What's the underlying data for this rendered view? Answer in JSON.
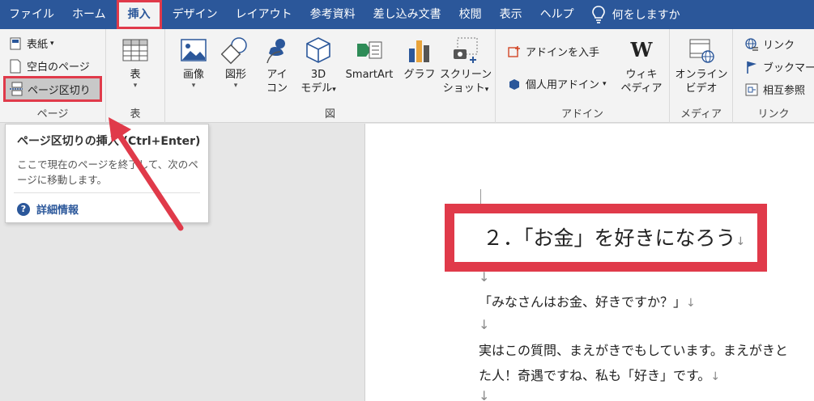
{
  "tabs": [
    {
      "label": "ファイル"
    },
    {
      "label": "ホーム"
    },
    {
      "label": "挿入"
    },
    {
      "label": "デザイン"
    },
    {
      "label": "レイアウト"
    },
    {
      "label": "参考資料"
    },
    {
      "label": "差し込み文書"
    },
    {
      "label": "校閲"
    },
    {
      "label": "表示"
    },
    {
      "label": "ヘルプ"
    }
  ],
  "tell_me": "何をしますか",
  "groups": {
    "page": {
      "label": "ページ",
      "cover": "表紙",
      "blank": "空白のページ",
      "page_break": "ページ区切り"
    },
    "table": {
      "label": "表",
      "button": "表"
    },
    "illustrations": {
      "label": "図",
      "picture": "画像",
      "shapes": "図形",
      "icons_1": "アイ",
      "icons_2": "コン",
      "model_1": "3D",
      "model_2": "モデル",
      "smartart": "SmartArt",
      "chart": "グラフ",
      "screenshot_1": "スクリーン",
      "screenshot_2": "ショット"
    },
    "addins": {
      "label": "アドイン",
      "get": "アドインを入手",
      "my": "個人用アドイン",
      "wiki_1": "ウィキ",
      "wiki_2": "ペディア"
    },
    "media": {
      "label": "メディア",
      "video_1": "オンライン",
      "video_2": "ビデオ"
    },
    "links": {
      "label": "リンク",
      "link": "リンク",
      "bookmark": "ブックマーク",
      "crossref": "相互参照"
    }
  },
  "tooltip": {
    "title": "ページ区切りの挿入 (Ctrl+Enter)",
    "desc": "ここで現在のページを終了して、次のページに移動します。",
    "more": "詳細情報"
  },
  "document": {
    "heading": "２．「お金」を好きになろう",
    "line1": "「みなさんはお金、好きですか？」",
    "line2": "実はこの質問、まえがきでもしています。まえがきと",
    "line3": "た人！奇遇ですね、私も「好き」です。"
  },
  "colors": {
    "brand": "#2b579a",
    "highlight": "#e03a4a"
  }
}
